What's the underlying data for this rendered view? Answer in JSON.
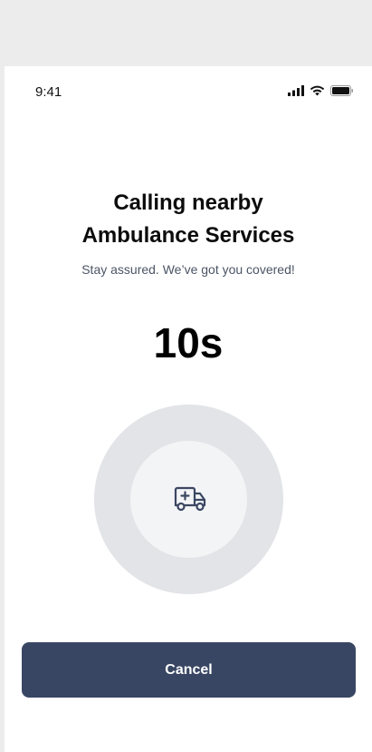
{
  "status_bar": {
    "time": "9:41",
    "icons": [
      "cellular-signal-icon",
      "wifi-icon",
      "battery-icon"
    ]
  },
  "call": {
    "title_line1": "Calling nearby",
    "title_line2": "Ambulance Services",
    "subtitle": "Stay assured. We’ve got you covered!",
    "countdown": "10s",
    "icon": "ambulance-icon"
  },
  "actions": {
    "cancel_label": "Cancel"
  },
  "colors": {
    "primary_button": "#394663",
    "outer_ring": "#e2e4e7",
    "inner_ring": "#f3f4f6",
    "icon_stroke": "#3b4761"
  }
}
